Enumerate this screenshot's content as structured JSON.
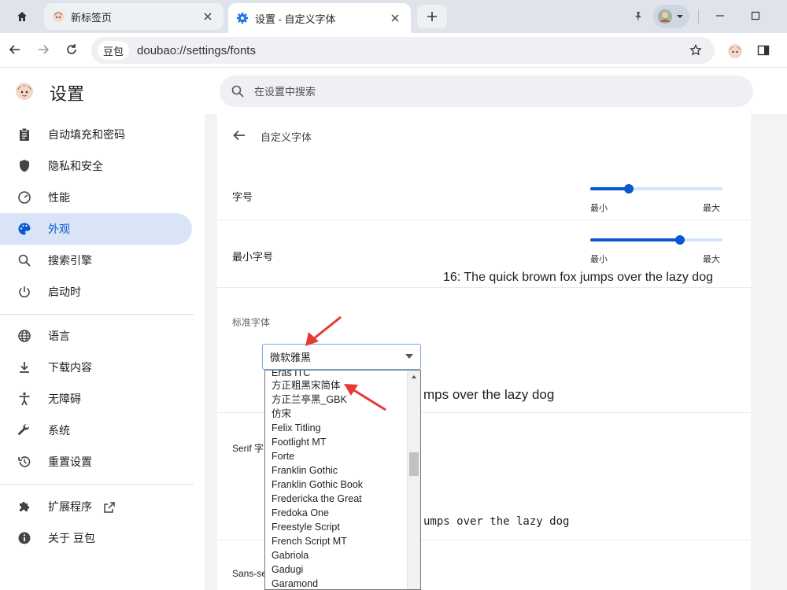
{
  "browser": {
    "tabs": [
      {
        "title": "新标签页",
        "active": false
      },
      {
        "title": "设置 - 自定义字体",
        "active": true
      }
    ],
    "url_chip": "豆包",
    "url": "doubao://settings/fonts"
  },
  "settings": {
    "title": "设置",
    "search_placeholder": "在设置中搜索"
  },
  "sidebar": {
    "items": [
      {
        "label": "自动填充和密码",
        "icon": "clipboard-icon"
      },
      {
        "label": "隐私和安全",
        "icon": "shield-icon"
      },
      {
        "label": "性能",
        "icon": "speedometer-icon"
      },
      {
        "label": "外观",
        "icon": "palette-icon",
        "selected": true
      },
      {
        "label": "搜索引擎",
        "icon": "search-icon"
      },
      {
        "label": "启动时",
        "icon": "power-icon"
      },
      {
        "label": "语言",
        "icon": "globe-icon"
      },
      {
        "label": "下载内容",
        "icon": "download-icon"
      },
      {
        "label": "无障碍",
        "icon": "accessibility-icon"
      },
      {
        "label": "系统",
        "icon": "wrench-icon"
      },
      {
        "label": "重置设置",
        "icon": "history-icon"
      },
      {
        "label": "扩展程序",
        "icon": "puzzle-icon"
      },
      {
        "label": "关于 豆包",
        "icon": "info-icon"
      }
    ]
  },
  "fonts_page": {
    "title": "自定义字体",
    "font_size": {
      "label": "字号",
      "min_label": "最小",
      "max_label": "最大",
      "value_fraction": 0.29
    },
    "min_font_size": {
      "label": "最小字号",
      "min_label": "最小",
      "max_label": "最大",
      "value_fraction": 0.68
    },
    "preview_16": "16: The quick brown fox jumps over the lazy dog",
    "standard_font": {
      "label": "标准字体",
      "selected": "微软雅黑",
      "preview_fragment": "mps over the lazy dog"
    },
    "serif_font": {
      "label_fragment": "Serif 字",
      "preview_fragment": "umps over the lazy dog"
    },
    "sans_font": {
      "label_fragment": "Sans-se"
    },
    "dropdown_options": [
      "Eras ITC",
      "方正粗黑宋简体",
      "方正兰亭黑_GBK",
      "仿宋",
      "Felix Titling",
      "Footlight MT",
      "Forte",
      "Franklin Gothic",
      "Franklin Gothic Book",
      "Fredericka the Great",
      "Fredoka One",
      "Freestyle Script",
      "French Script MT",
      "Gabriola",
      "Gadugi",
      "Garamond"
    ]
  },
  "colors": {
    "accent": "#0b57d0",
    "selected_nav_bg": "#d9e5f7",
    "annotation_arrow": "#e53935"
  }
}
